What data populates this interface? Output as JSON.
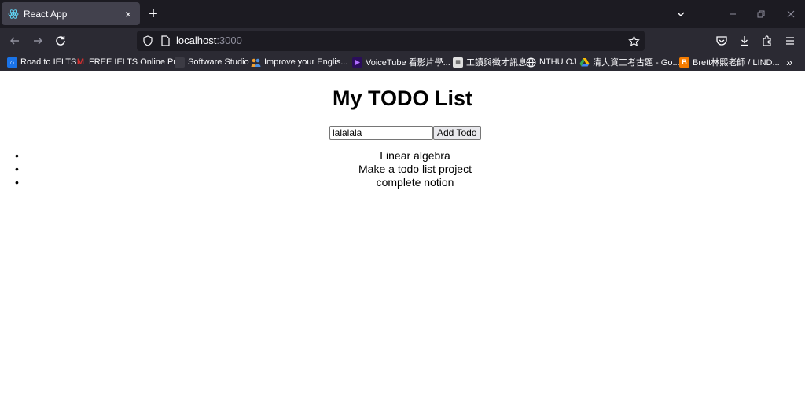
{
  "browser": {
    "tab": {
      "title": "React App",
      "close": "×"
    },
    "new_tab": "+",
    "url": {
      "host": "localhost",
      "port": ":3000"
    },
    "bookmarks": [
      {
        "label": "Road to IELTS",
        "icon": "ielts-icon",
        "color": "#1a73e8"
      },
      {
        "label": "FREE IELTS Online Pr...",
        "icon": "m-icon",
        "color": "#d32f2f"
      },
      {
        "label": "Software Studio",
        "icon": "studio-icon",
        "color": "#3c3b44"
      },
      {
        "label": "Improve your Englis...",
        "icon": "people-icon",
        "color": "#f0a030"
      },
      {
        "label": "VoiceTube 看影片學...",
        "icon": "play-icon",
        "color": "#5b2fb0"
      },
      {
        "label": "工讀與徵才訊息",
        "icon": "nthu-icon",
        "color": "#e0e0e0"
      },
      {
        "label": "NTHU OJ",
        "icon": "globe-icon",
        "color": "#2b2a33"
      },
      {
        "label": "清大資工考古題 - Go...",
        "icon": "drive-icon",
        "color": "#34a853"
      },
      {
        "label": "Brett林熙老師 / LIND...",
        "icon": "blogger-icon",
        "color": "#f57c00"
      }
    ],
    "more_bookmarks": "»"
  },
  "page": {
    "title": "My TODO List",
    "input_value": "lalalala",
    "add_button": "Add Todo",
    "todos": [
      "Linear algebra",
      "Make a todo list project",
      "complete notion"
    ]
  }
}
